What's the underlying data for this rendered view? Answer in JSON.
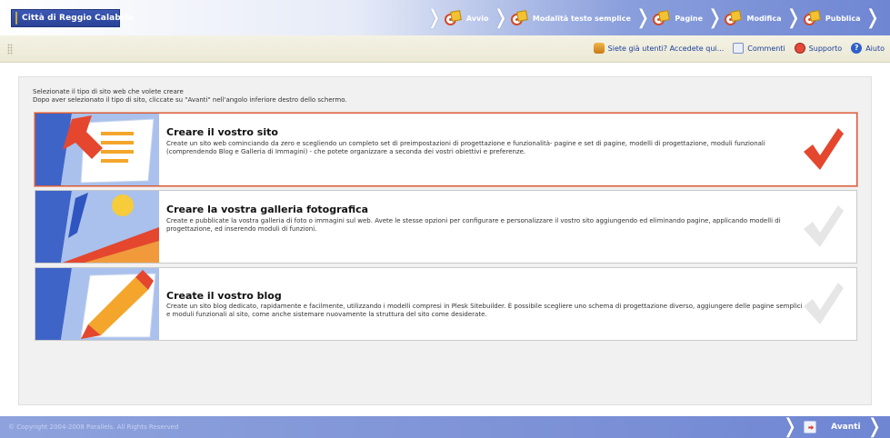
{
  "header": {
    "logo_text": "Città di Reggio Calabria",
    "steps": [
      {
        "label": "Avvio",
        "icon": "start-icon"
      },
      {
        "label": "Modalità testo semplice",
        "icon": "text-mode-icon"
      },
      {
        "label": "Pagine",
        "icon": "pages-icon"
      },
      {
        "label": "Modifica",
        "icon": "edit-icon"
      },
      {
        "label": "Pubblica",
        "icon": "publish-icon"
      }
    ]
  },
  "subbar": {
    "links": [
      {
        "label": "Siete già utenti? Accedete qui...",
        "icon": "users-icon"
      },
      {
        "label": "Commenti",
        "icon": "comments-icon"
      },
      {
        "label": "Supporto",
        "icon": "support-icon"
      },
      {
        "label": "Aiuto",
        "icon": "help-icon"
      }
    ]
  },
  "main": {
    "intro_line1": "Selezionate il tipo di sito web che volete creare",
    "intro_line2": "Dopo aver selezionato il tipo di sito, cliccate su \"Avanti\" nell'angolo inferiore destro dello schermo.",
    "options": [
      {
        "title": "Creare il vostro sito",
        "description": "Create un sito web cominciando da zero e scegliendo un completo set di preimpostazioni di progettazione e funzionalità- pagine e set di pagine, modelli di progettazione, moduli funzionali (comprendendo Blog e Galleria di Immagini) - che potete organizzare a seconda dei vostri obiettivi e preferenze.",
        "selected": true
      },
      {
        "title": "Creare la vostra galleria fotografica",
        "description": "Create e pubblicate la vostra galleria di foto o immagini sul web. Avete le stesse opzioni per configurare e personalizzare il vostro sito aggiungendo ed eliminando pagine, applicando modelli di progettazione, ed inserendo moduli di funzioni.",
        "selected": false
      },
      {
        "title": "Create il vostro blog",
        "description": "Create un sito blog dedicato, rapidamente e facilmente, utilizzando i modelli compresi in Plesk Sitebuilder. È possibile scegliere uno schema di progettazione diverso, aggiungere delle pagine semplici e moduli funzionali al sito, come anche sistemare nuovamente la struttura del sito come desiderate.",
        "selected": false
      }
    ]
  },
  "footer": {
    "copyright": "© Copyright 2004-2008 Parallels. All Rights Reserved",
    "next_label": "Avanti"
  },
  "colors": {
    "banner_blue": "#6f86d3",
    "selected_border": "#d65a3a",
    "check_red": "#e4472e",
    "check_grey": "#e3e3e3",
    "link_blue": "#1a3f9c"
  }
}
